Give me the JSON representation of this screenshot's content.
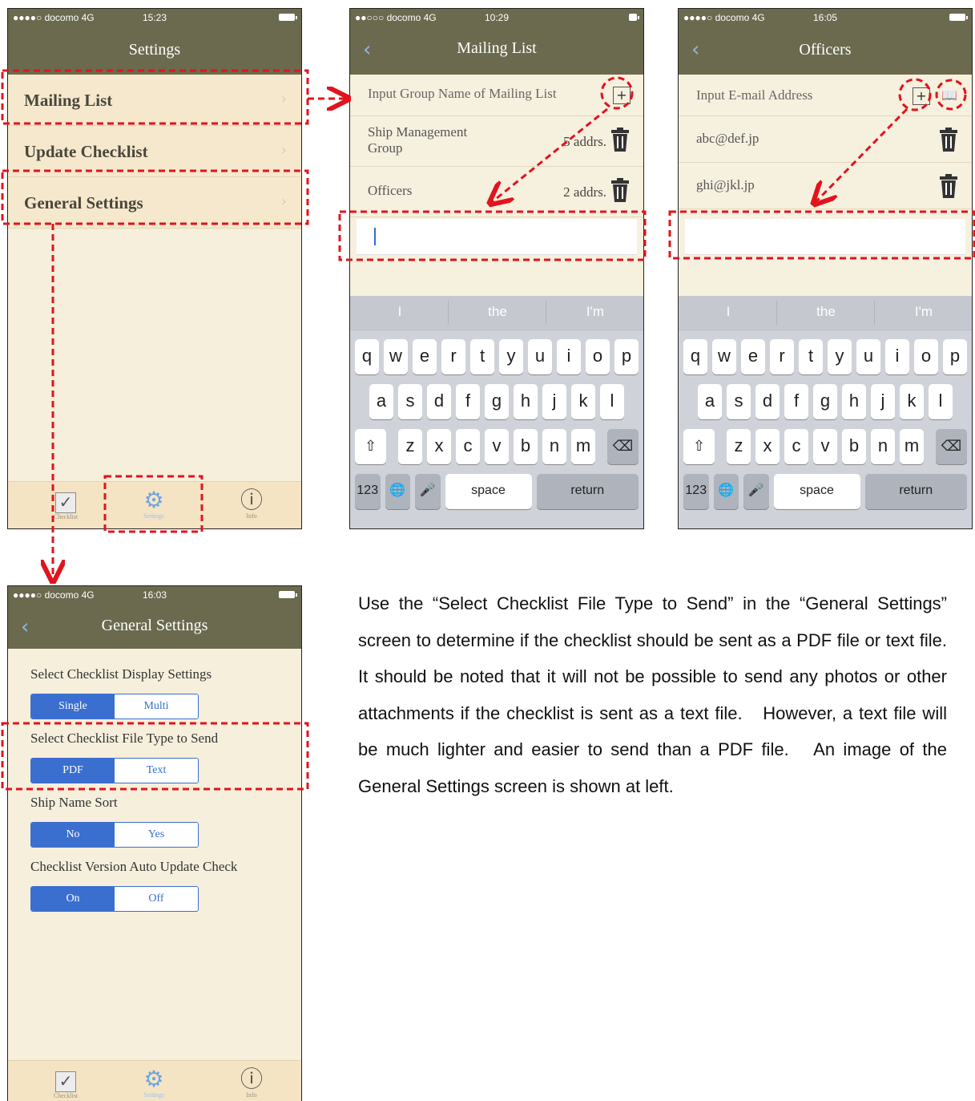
{
  "screen1": {
    "status": {
      "signal": "●●●●○ docomo  4G",
      "time": "15:23"
    },
    "title": "Settings",
    "menu": [
      "Mailing List",
      "Update Checklist",
      "General Settings"
    ],
    "tabs": [
      {
        "label": "Checklist",
        "icon": "checkbox-icon"
      },
      {
        "label": "Settings",
        "icon": "gear-icon"
      },
      {
        "label": "Info",
        "icon": "info-icon"
      }
    ]
  },
  "screen2": {
    "status": {
      "signal": "●●○○○ docomo  4G",
      "time": "10:29"
    },
    "title": "Mailing List",
    "input_placeholder": "Input Group Name of Mailing List",
    "rows": [
      {
        "name": "Ship Management Group",
        "count": "5 addrs."
      },
      {
        "name": "Officers",
        "count": "2 addrs."
      }
    ]
  },
  "screen3": {
    "status": {
      "signal": "●●●●○ docomo  4G",
      "time": "16:05"
    },
    "title": "Officers",
    "input_placeholder": "Input E-mail Address",
    "emails": [
      "abc@def.jp",
      "ghi@jkl.jp"
    ]
  },
  "keyboard": {
    "suggestions": [
      "I",
      "the",
      "I'm"
    ],
    "row1": [
      "q",
      "w",
      "e",
      "r",
      "t",
      "y",
      "u",
      "i",
      "o",
      "p"
    ],
    "row2": [
      "a",
      "s",
      "d",
      "f",
      "g",
      "h",
      "j",
      "k",
      "l"
    ],
    "row3": [
      "z",
      "x",
      "c",
      "v",
      "b",
      "n",
      "m"
    ],
    "numbers": "123",
    "space": "space",
    "return": "return"
  },
  "screen4": {
    "status": {
      "signal": "●●●●○ docomo  4G",
      "time": "16:03"
    },
    "title": "General Settings",
    "settings": [
      {
        "label": "Select Checklist Display Settings",
        "options": [
          "Single",
          "Multi"
        ],
        "selected": "Single"
      },
      {
        "label": "Select Checklist File Type to Send",
        "options": [
          "PDF",
          "Text"
        ],
        "selected": "PDF"
      },
      {
        "label": "Ship Name Sort",
        "options": [
          "No",
          "Yes"
        ],
        "selected": "No"
      },
      {
        "label": "Checklist Version Auto Update Check",
        "options": [
          "On",
          "Off"
        ],
        "selected": "On"
      }
    ]
  },
  "caption": "Use the “Select Checklist File Type to Send” in the “General Settings” screen to determine if the checklist should be sent as a PDF file or text file.　It should be noted that it will not be possible to send any photos or other attachments if the checklist is sent as a text file.　However, a text file will be much lighter and easier to send than a PDF file.　An image of the General Settings screen is shown at left.",
  "colors": {
    "navbar": "#6b6a4f",
    "accent": "#3a6fd0",
    "highlight": "#e0141e"
  }
}
